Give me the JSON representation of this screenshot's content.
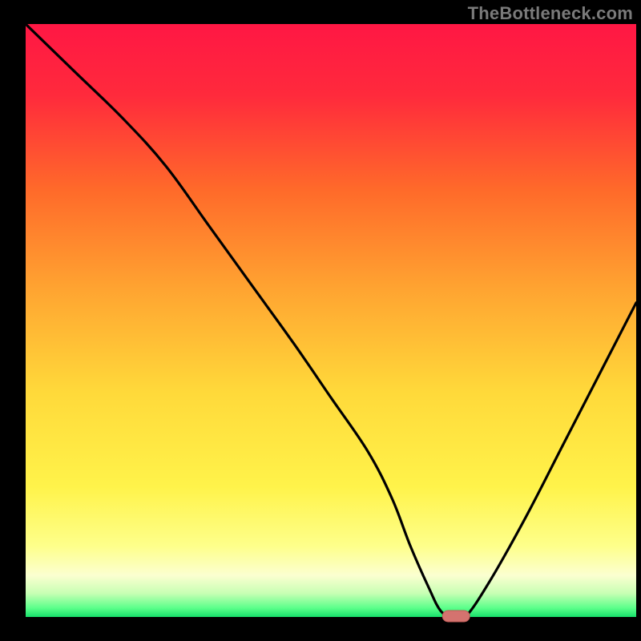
{
  "watermark": {
    "text": "TheBottleneck.com"
  },
  "colors": {
    "background": "#000000",
    "gradient_stops": [
      {
        "offset": 0.0,
        "color": "#ff1744"
      },
      {
        "offset": 0.12,
        "color": "#ff2a3c"
      },
      {
        "offset": 0.28,
        "color": "#ff6a2a"
      },
      {
        "offset": 0.45,
        "color": "#ffa531"
      },
      {
        "offset": 0.62,
        "color": "#ffd93a"
      },
      {
        "offset": 0.78,
        "color": "#fff34a"
      },
      {
        "offset": 0.88,
        "color": "#feff8a"
      },
      {
        "offset": 0.93,
        "color": "#fbffd0"
      },
      {
        "offset": 0.96,
        "color": "#c8ffb4"
      },
      {
        "offset": 0.985,
        "color": "#5bff8a"
      },
      {
        "offset": 1.0,
        "color": "#17e06b"
      }
    ],
    "curve": "#000000",
    "marker_fill": "#d4736f",
    "marker_stroke": "#c05b57"
  },
  "chart_data": {
    "type": "line",
    "title": "",
    "xlabel": "",
    "ylabel": "",
    "xlim": [
      0,
      100
    ],
    "ylim": [
      0,
      100
    ],
    "series": [
      {
        "name": "bottleneck-curve",
        "x": [
          0,
          8,
          16,
          23,
          30,
          37,
          44,
          50,
          56,
          60,
          63,
          66,
          68,
          70,
          72,
          76,
          82,
          88,
          94,
          100
        ],
        "y": [
          100,
          92,
          84,
          76,
          66,
          56,
          46,
          37,
          28,
          20,
          12,
          5,
          1,
          0,
          0,
          6,
          17,
          29,
          41,
          53
        ]
      }
    ],
    "marker": {
      "x": 70.5,
      "y": 0
    },
    "notes": "y is percentage height measured from the green baseline; curve starts at upper-left, dips to ~0 near x≈68–72, rises to mid height at right edge"
  },
  "layout": {
    "inner_left": 32,
    "inner_top": 30,
    "inner_right": 794,
    "inner_bottom": 770
  }
}
